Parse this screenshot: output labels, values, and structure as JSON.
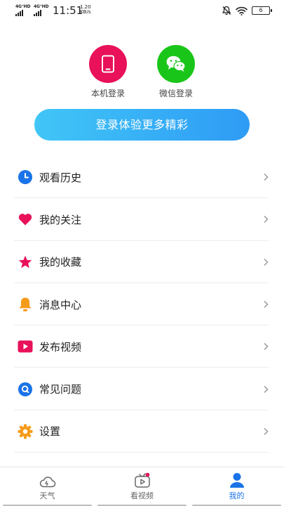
{
  "status_bar": {
    "sim1_label": "4G⁺HD",
    "sim2_label": "4G⁺HD",
    "time": "11:51",
    "speed_value": "1.20",
    "speed_unit": "KB/s",
    "battery_level": "6"
  },
  "login": {
    "phone_login_label": "本机登录",
    "wechat_login_label": "微信登录",
    "login_button_label": "登录体验更多精彩",
    "colors": {
      "phone": "#e8115a",
      "wechat": "#1ac51a",
      "button_start": "#41c6f7",
      "button_end": "#2e9bf5"
    }
  },
  "menu": {
    "items": [
      {
        "label": "观看历史",
        "icon": "clock-icon"
      },
      {
        "label": "我的关注",
        "icon": "heart-icon"
      },
      {
        "label": "我的收藏",
        "icon": "star-icon"
      },
      {
        "label": "消息中心",
        "icon": "bell-icon"
      },
      {
        "label": "发布视频",
        "icon": "play-icon"
      },
      {
        "label": "常见问题",
        "icon": "question-icon"
      },
      {
        "label": "设置",
        "icon": "gear-icon"
      }
    ]
  },
  "tabbar": {
    "tabs": [
      {
        "label": "天气",
        "icon": "cloud-icon",
        "active": false
      },
      {
        "label": "看视频",
        "icon": "tv-icon",
        "active": false,
        "badge": true
      },
      {
        "label": "我的",
        "icon": "person-icon",
        "active": true
      }
    ],
    "active_color": "#1a73e8"
  }
}
